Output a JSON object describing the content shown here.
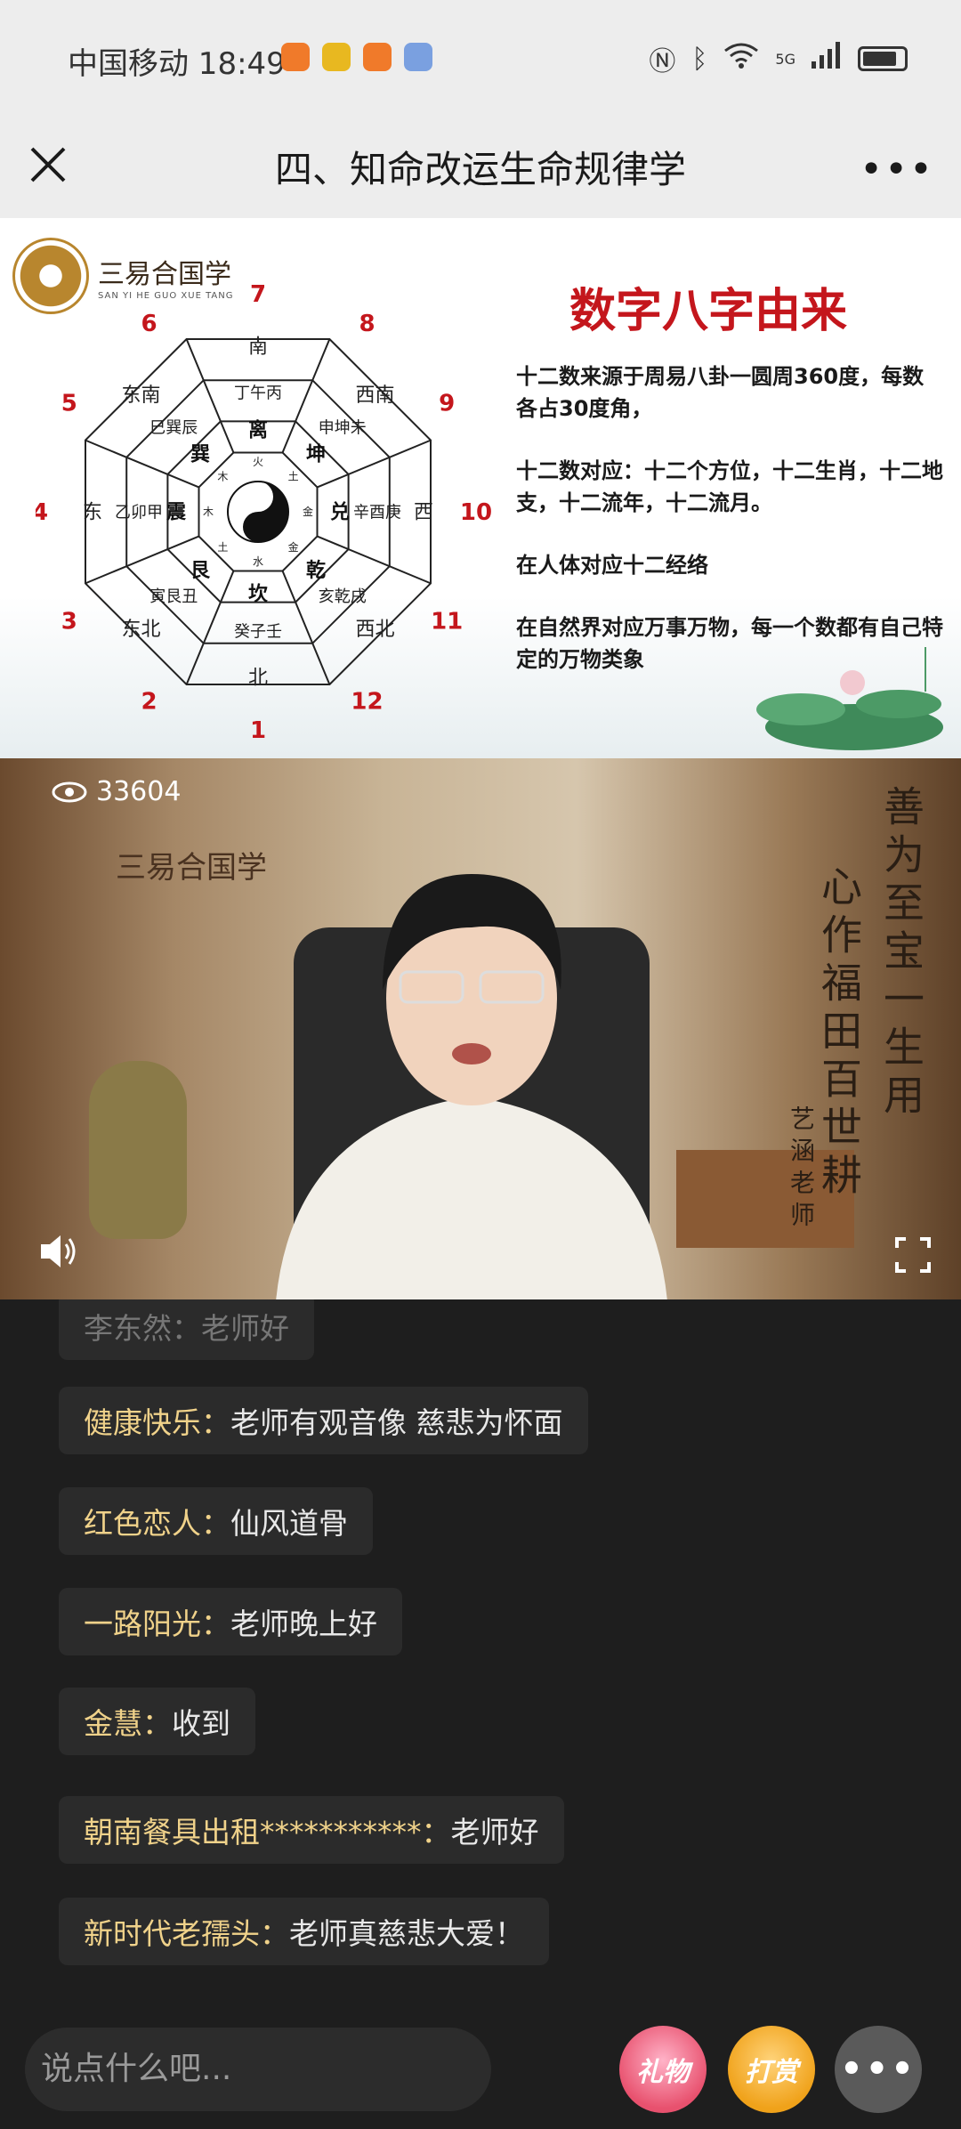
{
  "status_bar": {
    "carrier_time": "中国移动 18:49",
    "network": "5G"
  },
  "header": {
    "title": "四、知命改运生命规律学"
  },
  "slide": {
    "logo_name": "三易合国学",
    "logo_sub": "SAN YI HE GUO XUE TANG",
    "title": "数字八字由来",
    "paragraphs": [
      "十二数来源于周易八卦一圆周360度，每数各占30度角，",
      "十二数对应：十二个方位，十二生肖，十二地支，十二流年，十二流月。",
      "在人体对应十二经络",
      "在自然界对应万事万物，每一个数都有自己特定的万物类象"
    ],
    "diagram": {
      "numbers": [
        "1",
        "2",
        "3",
        "4",
        "5",
        "6",
        "7",
        "8",
        "9",
        "10",
        "11",
        "12"
      ],
      "directions": [
        "北",
        "东北",
        "东",
        "东南",
        "南",
        "西南",
        "西",
        "西北"
      ],
      "branches": [
        "癸子壬",
        "寅艮丑",
        "乙卯甲",
        "巳巽辰",
        "丁午丙",
        "申坤未",
        "辛酉庚",
        "亥乾戌"
      ],
      "trigrams": [
        "坎",
        "艮",
        "震",
        "巽",
        "离",
        "坤",
        "兑",
        "乾"
      ],
      "elements": [
        "水",
        "土",
        "木",
        "木",
        "火",
        "土",
        "金",
        "金"
      ]
    }
  },
  "video": {
    "view_count": "33604",
    "watermark": "三易合国学",
    "calligraphy_right": "善为至宝一生用",
    "calligraphy_mid": "心作福田百世耕",
    "calligraphy_sign": "艺涵老师"
  },
  "chat": {
    "messages": [
      {
        "user": "李东然：",
        "text": "老师好"
      },
      {
        "user": "健康快乐：",
        "text": "老师有观音像 慈悲为怀面"
      },
      {
        "user": "红色恋人：",
        "text": "仙风道骨"
      },
      {
        "user": "一路阳光：",
        "text": "老师晚上好"
      },
      {
        "user": "金慧：",
        "text": "收到"
      },
      {
        "user": "朝南餐具出租***********：",
        "text": "老师好"
      },
      {
        "user": "新时代老孺头：",
        "text": "老师真慈悲大爱！"
      }
    ]
  },
  "input": {
    "placeholder": "说点什么吧...",
    "gift_label": "礼物",
    "tip_label": "打赏"
  },
  "colors": {
    "slide_title": "#c4161c",
    "chat_user": "#f0d28a",
    "background": "#1e1e1e"
  }
}
